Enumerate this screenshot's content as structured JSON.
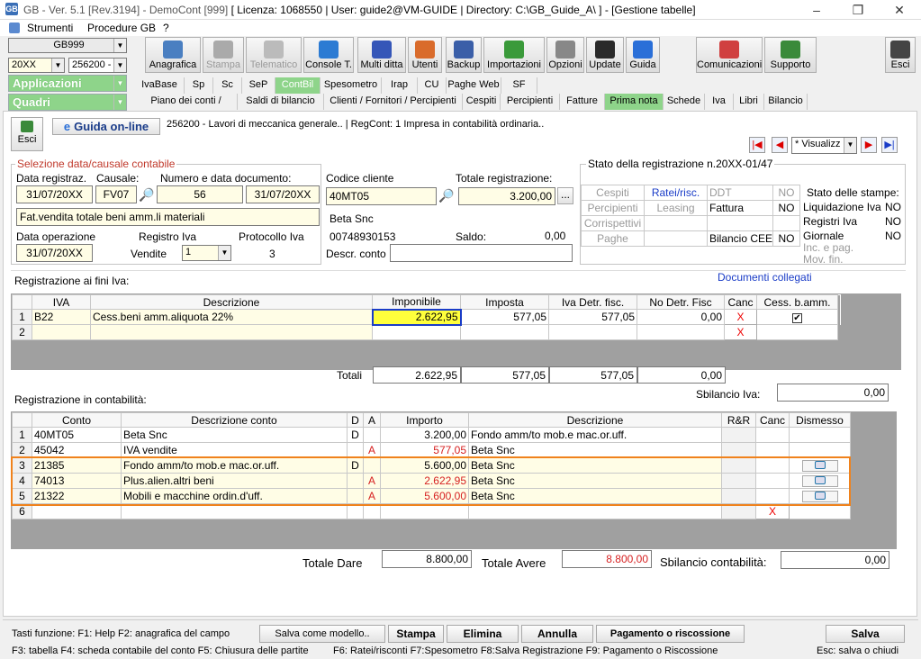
{
  "window": {
    "title_prefix": "GB - Ver. 5.1 [Rev.3194] - DemoCont [999]",
    "title_main": "[ Licenza: 1068550 | User: guide2@VM-GUIDE | Directory: C:\\GB_Guide_A\\ ] - [Gestione tabelle]",
    "logo": "GB"
  },
  "menu": {
    "strumenti": "Strumenti",
    "procedure": "Procedure GB",
    "help": "?"
  },
  "left": {
    "company": "GB999",
    "year": "20XX",
    "code": "256200 -",
    "applicazioni": "Applicazioni",
    "quadri": "Quadri"
  },
  "toolbar": [
    {
      "label": "Anagrafica",
      "icon": "address-book-icon",
      "color": "#4a7fc1"
    },
    {
      "label": "Stampa",
      "icon": "printer-icon",
      "color": "#aaaaaa"
    },
    {
      "label": "Telematico",
      "icon": "telematic-icon",
      "color": "#bbbbbb"
    },
    {
      "label": "Console T.",
      "icon": "console-icon",
      "color": "#2c7bd3"
    },
    {
      "label": "Multi ditta",
      "icon": "multi-company-icon",
      "color": "#3556b8"
    },
    {
      "label": "Utenti",
      "icon": "users-icon",
      "color": "#d96b2b"
    },
    {
      "label": "Backup",
      "icon": "backup-icon",
      "color": "#3b5fa8"
    },
    {
      "label": "Importazioni",
      "icon": "import-icon",
      "color": "#3a9a3a"
    },
    {
      "label": "Opzioni",
      "icon": "wrench-icon",
      "color": "#888888"
    },
    {
      "label": "Update",
      "icon": "update-icon",
      "color": "#2a2a2a"
    },
    {
      "label": "Guida",
      "icon": "help-icon",
      "color": "#2a6fd8"
    },
    {
      "label": "Comunicazioni",
      "icon": "communications-icon",
      "color": "#d04040"
    },
    {
      "label": "Supporto",
      "icon": "support-icon",
      "color": "#3a8a3a"
    },
    {
      "label": "Esci",
      "icon": "exit-icon",
      "color": "#444444"
    }
  ],
  "tabs1": [
    "IvaBase",
    "Sp",
    "Sc",
    "SeP",
    "ContBil",
    "Spesometro",
    "Irap",
    "CU",
    "Paghe Web",
    "SF"
  ],
  "tabs2": [
    "Piano dei conti / Causali",
    "Saldi di bilancio",
    "Clienti / Fornitori / Percipienti",
    "Cespiti",
    "Percipienti",
    "Fatture",
    "Prima nota",
    "Schede",
    "Iva",
    "Libri",
    "Bilancio"
  ],
  "header": {
    "esci": "Esci",
    "guida": "Guida on-line",
    "info": "256200 - Lavori di meccanica generale.. | RegCont: 1 Impresa  in contabilità ordinaria..",
    "mode": "* Visualizz"
  },
  "selezione": {
    "title": "Selezione data/causale contabile",
    "data_reg_label": "Data registraz.",
    "causale_label": "Causale:",
    "numero_label": "Numero e data documento:",
    "data_reg": "31/07/20XX",
    "causale": "FV07",
    "numero": "56",
    "data_doc": "31/07/20XX",
    "descrizione": "Fat.vendita totale beni amm.li materiali",
    "data_op_label": "Data operazione",
    "reg_iva_label": "Registro Iva",
    "protocollo_label": "Protocollo Iva",
    "data_op": "31/07/20XX",
    "vendite": "Vendite",
    "reg_iva": "1",
    "protocollo": "3"
  },
  "cliente": {
    "codice_label": "Codice cliente",
    "totale_label": "Totale registrazione:",
    "codice": "40MT05",
    "totale": "3.200,00",
    "dots": "...",
    "nome": "Beta Snc",
    "piva": "00748930153",
    "saldo_label": "Saldo:",
    "saldo": "0,00",
    "descr_conto_label": "Descr. conto"
  },
  "stato": {
    "title": "Stato della registrazione n.20XX-01/47",
    "cespiti": "Cespiti",
    "ratei": "Ratei/risc.",
    "ddt": "DDT",
    "no1": "NO",
    "percipienti": "Percipienti",
    "leasing": "Leasing",
    "fattura": "Fattura",
    "no2": "NO",
    "corrispettivi": "Corrispettivi",
    "paghe": "Paghe",
    "bilancio_cee": "Bilancio CEE",
    "no3": "NO",
    "stampe_title": "Stato delle stampe:",
    "liq_iva": "Liquidazione Iva",
    "liq_iva_v": "NO",
    "reg_iva": "Registri Iva",
    "reg_iva_v": "NO",
    "giornale": "Giornale",
    "giornale_v": "NO",
    "inc_pag": "Inc. e pag.",
    "mov_fin": "Mov. fin."
  },
  "iva": {
    "title": "Registrazione ai fini Iva:",
    "doc_link": "Documenti collegati",
    "headers": [
      "IVA",
      "Descrizione",
      "Imponibile",
      "Imposta",
      "Iva Detr. fisc.",
      "No Detr. Fisc",
      "Canc",
      "Cess. b.amm."
    ],
    "rows": [
      {
        "n": "1",
        "iva": "B22",
        "descr": "Cess.beni amm.aliquota 22%",
        "imponibile": "2.622,95",
        "imposta": "577,05",
        "detr": "577,05",
        "nodetr": "0,00",
        "canc": "X",
        "cess": "✔"
      },
      {
        "n": "2",
        "iva": "",
        "descr": "",
        "imponibile": "",
        "imposta": "",
        "detr": "",
        "nodetr": "",
        "canc": "X",
        "cess": ""
      }
    ],
    "totali_label": "Totali",
    "tot_imponibile": "2.622,95",
    "tot_imposta": "577,05",
    "tot_detr": "577,05",
    "tot_nodetr": "0,00",
    "sbilancio_label": "Sbilancio Iva:",
    "sbilancio": "0,00"
  },
  "contab": {
    "title": "Registrazione in contabilità:",
    "headers": [
      "Conto",
      "Descrizione conto",
      "D",
      "A",
      "Importo",
      "Descrizione",
      "R&R",
      "Canc",
      "Dismesso"
    ],
    "rows": [
      {
        "n": "1",
        "conto": "40MT05",
        "descr_conto": "Beta Snc",
        "d": "D",
        "a": "",
        "importo": "3.200,00",
        "descr": "Fondo amm/to mob.e mac.or.uff.",
        "red": false,
        "dism": false
      },
      {
        "n": "2",
        "conto": "45042",
        "descr_conto": "IVA vendite",
        "d": "",
        "a": "A",
        "importo": "577,05",
        "descr": "Beta Snc",
        "red": true,
        "dism": false
      },
      {
        "n": "3",
        "conto": "21385",
        "descr_conto": "Fondo amm/to mob.e mac.or.uff.",
        "d": "D",
        "a": "",
        "importo": "5.600,00",
        "descr": "Beta Snc",
        "red": false,
        "dism": true
      },
      {
        "n": "4",
        "conto": "74013",
        "descr_conto": "Plus.alien.altri beni",
        "d": "",
        "a": "A",
        "importo": "2.622,95",
        "descr": "Beta Snc",
        "red": true,
        "dism": true
      },
      {
        "n": "5",
        "conto": "21322",
        "descr_conto": "Mobili e macchine ordin.d'uff.",
        "d": "",
        "a": "A",
        "importo": "5.600,00",
        "descr": "Beta Snc",
        "red": true,
        "dism": true
      },
      {
        "n": "6",
        "conto": "",
        "descr_conto": "",
        "d": "",
        "a": "",
        "importo": "",
        "descr": "",
        "red": false,
        "dism": false,
        "canc": "X"
      }
    ],
    "tot_dare_label": "Totale Dare",
    "tot_dare": "8.800,00",
    "tot_avere_label": "Totale Avere",
    "tot_avere": "8.800,00",
    "sbil_label": "Sbilancio contabilità:",
    "sbil": "0,00"
  },
  "footer": {
    "keys1": "Tasti funzione: F1: Help  F2: anagrafica del campo",
    "salva_modello": "Salva come modello..",
    "stampa": "Stampa",
    "elimina": "Elimina",
    "annulla": "Annulla",
    "pagamento": "Pagamento o riscossione",
    "salva": "Salva",
    "keys2": "F3: tabella   F4: scheda contabile del conto   F5: Chiusura delle partite",
    "keys3": "F6: Ratei/risconti   F7:Spesometro      F8:Salva Registrazione      F9: Pagamento o Riscossione",
    "keys4": "Esc: salva o chiudi"
  },
  "colors": {
    "accent_green": "#8ed48a",
    "highlight": "#ffff3c",
    "orange_frame": "#f0821c",
    "red_text": "#d62020"
  }
}
